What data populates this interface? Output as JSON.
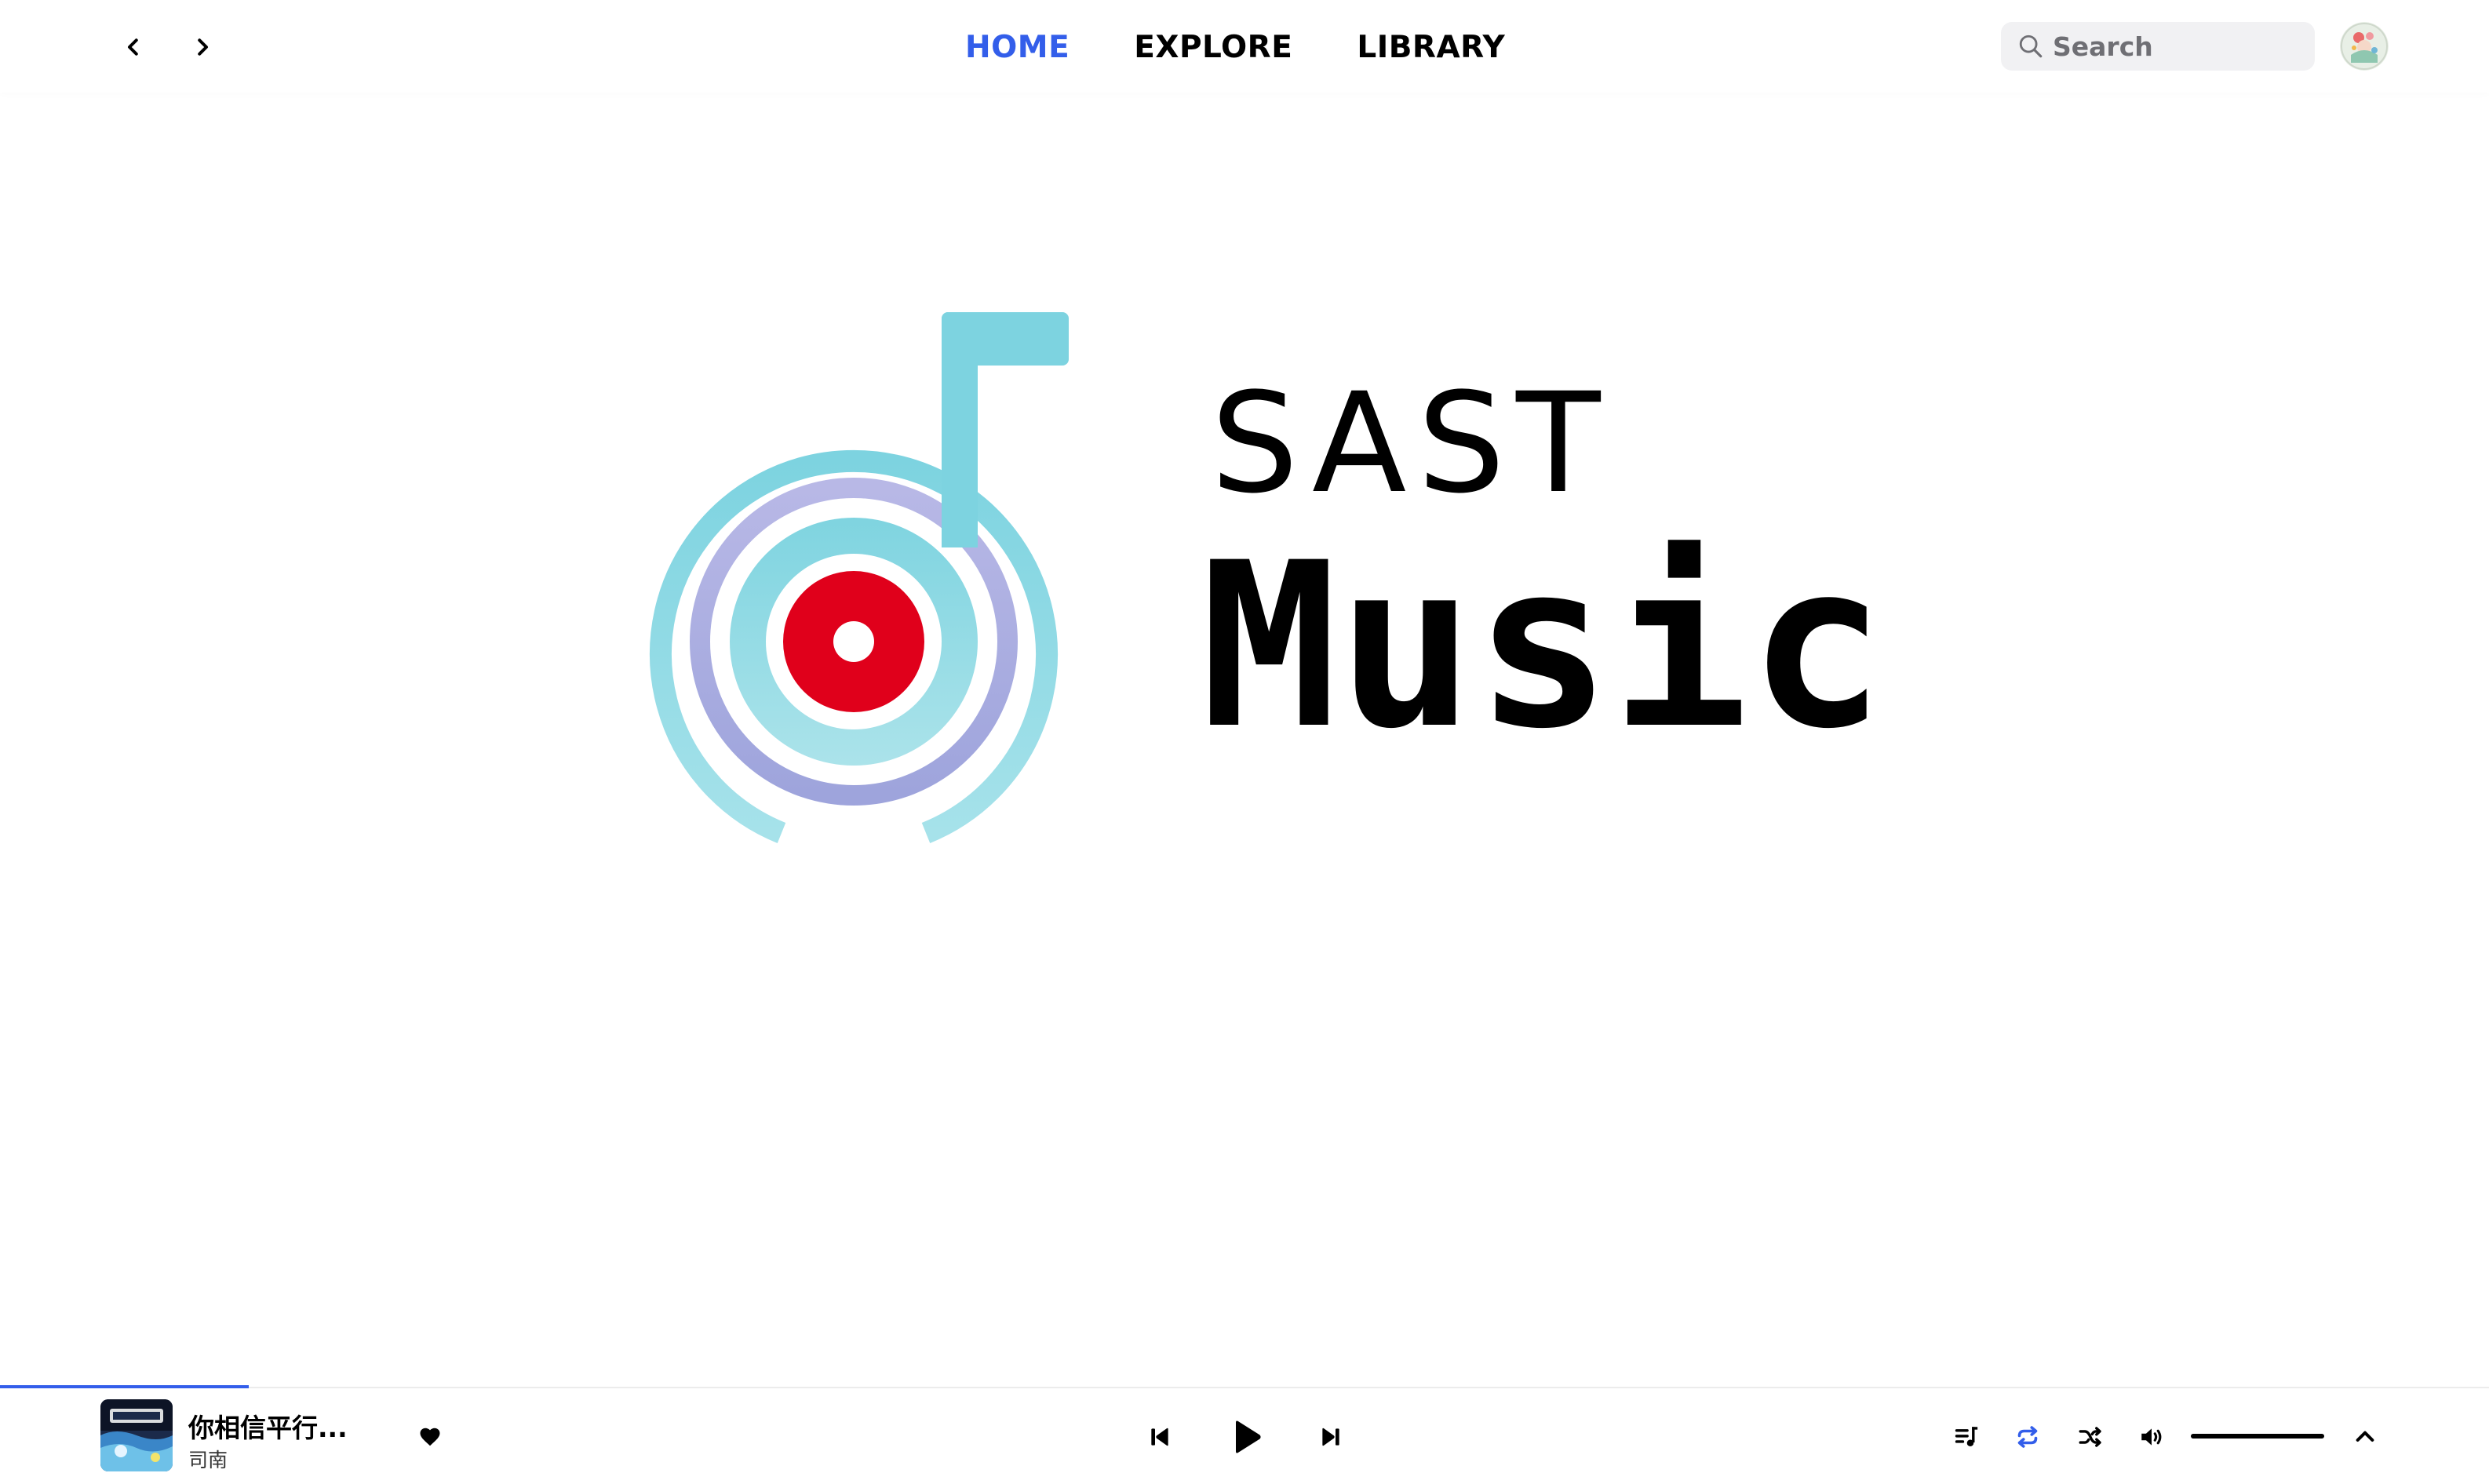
{
  "nav": {
    "back_icon": "chevron-left-icon",
    "forward_icon": "chevron-right-icon",
    "tabs": [
      {
        "label": "HOME",
        "active": true
      },
      {
        "label": "EXPLORE",
        "active": false
      },
      {
        "label": "LIBRARY",
        "active": false
      }
    ],
    "search": {
      "placeholder": "Search",
      "value": ""
    },
    "accent_color": "#335eea"
  },
  "hero": {
    "logo_icon": "music-note-record-logo",
    "title": "SAST",
    "subtitle": "Music",
    "colors": {
      "teal": "#7fd4e0",
      "lavender": "#a9acde",
      "red": "#e0001b"
    }
  },
  "player": {
    "track_title": "你相信平行...",
    "artist": "司南",
    "liked": true,
    "progress_fraction": 0.1,
    "is_playing": false,
    "repeat_active": true,
    "volume_fraction": 1.0
  }
}
